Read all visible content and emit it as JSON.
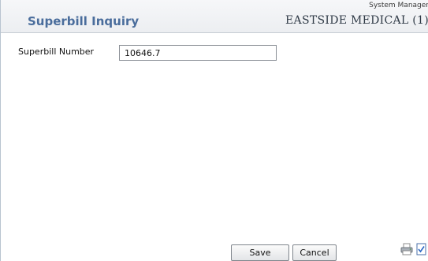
{
  "header": {
    "title": "Superbill Inquiry",
    "role": "System Manager",
    "organization": "EASTSIDE MEDICAL (1)"
  },
  "form": {
    "superbill_number_label": "Superbill Number",
    "superbill_number_value": "10646.7"
  },
  "footer": {
    "save_label": "Save",
    "cancel_label": "Cancel",
    "icons": [
      "printer-icon",
      "checklist-icon"
    ]
  },
  "colors": {
    "title": "#4a6d9c",
    "header_bg": "#eceef1"
  }
}
